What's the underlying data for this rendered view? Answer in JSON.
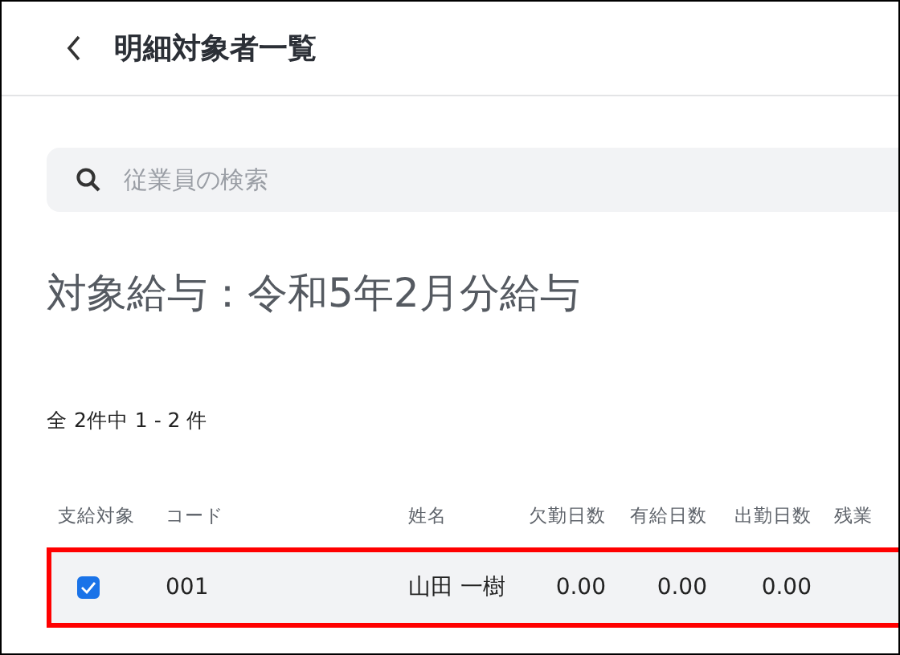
{
  "header": {
    "title": "明細対象者一覧"
  },
  "search": {
    "placeholder": "従業員の検索"
  },
  "heading": "対象給与：令和5年2月分給与",
  "count": "全 2件中 1 - 2 件",
  "table": {
    "columns": [
      "支給対象",
      "コード",
      "姓名",
      "欠勤日数",
      "有給日数",
      "出勤日数",
      "残業"
    ],
    "rows": [
      {
        "highlighted": true,
        "cells": [
          {
            "kind": "checkbox",
            "checked": true
          },
          {
            "kind": "text",
            "text": "001"
          },
          {
            "kind": "text",
            "text": "山田 一樹"
          },
          {
            "kind": "number",
            "text": "0.00"
          },
          {
            "kind": "number",
            "text": "0.00"
          },
          {
            "kind": "number",
            "text": "0.00"
          }
        ]
      }
    ]
  }
}
